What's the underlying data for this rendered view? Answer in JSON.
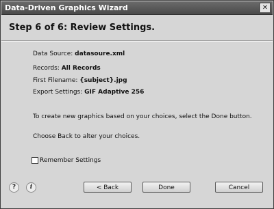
{
  "window": {
    "title": "Data-Driven Graphics Wizard",
    "close_label": "✕"
  },
  "header": {
    "step_title": "Step 6 of 6: Review Settings."
  },
  "summary": {
    "data_source_label": "Data Source:",
    "data_source_value": "datasoure.xml",
    "records_label": "Records:",
    "records_value": "All Records",
    "first_filename_label": "First Filename:",
    "first_filename_value": "{subject}.jpg",
    "export_settings_label": "Export Settings:",
    "export_settings_value": "GIF Adaptive 256"
  },
  "instructions": {
    "done_text": "To create new graphics based on your choices, select the Done button.",
    "back_text": "Choose Back to alter your choices."
  },
  "options": {
    "remember_label": "Remember Settings",
    "remember_checked": false
  },
  "footer": {
    "help_icon_label": "?",
    "info_icon_label": "i",
    "back_label": "< Back",
    "done_label": "Done",
    "cancel_label": "Cancel"
  }
}
